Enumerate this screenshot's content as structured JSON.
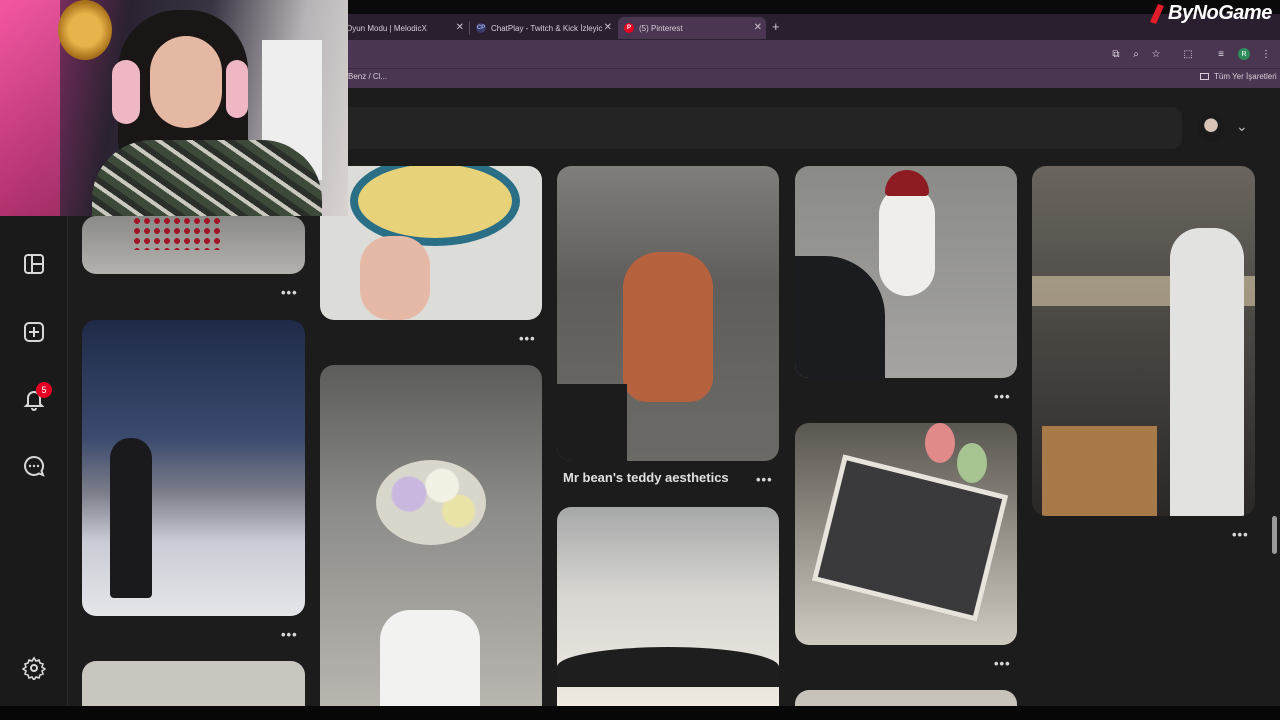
{
  "browser": {
    "tabs": [
      {
        "label": "Oyun Modu | MelodicX"
      },
      {
        "label": "ChatPlay - Twitch & Kick İzleyic"
      },
      {
        "label": "(5) Pinterest"
      }
    ],
    "bookmark_left": "Benz / Cl...",
    "bookmark_right": "Tüm Yer İşaretleri",
    "profile_initial": "R"
  },
  "watermark": {
    "text": "ByNoGame"
  },
  "sidebar": {
    "icons": [
      "boards-icon",
      "create-icon",
      "notifications-icon",
      "messages-icon",
      "settings-icon"
    ],
    "notification_count": "5"
  },
  "pins": [
    {
      "title": "Mr bean's teddy aesthetics"
    }
  ],
  "colors": {
    "accent": "#e60023",
    "page_bg": "#1c1c1c",
    "chrome": "#4a3650"
  }
}
